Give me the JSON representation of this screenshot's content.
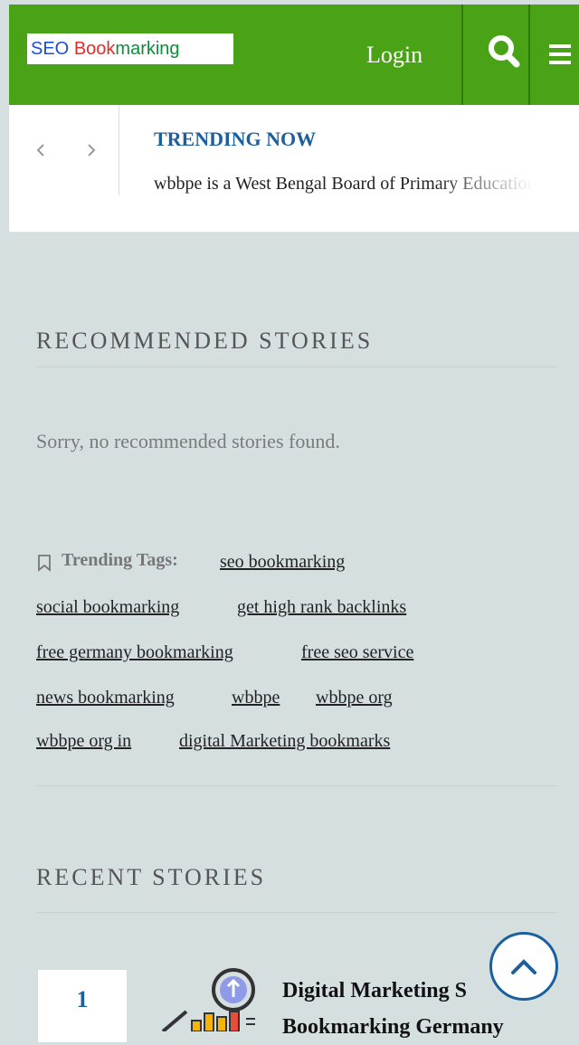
{
  "header": {
    "logo_text": "SEO Bookmarking",
    "login_label": "Login",
    "search_icon": "search-icon",
    "menu_icon": "hamburger-menu-icon",
    "bg_color": "#4aa316"
  },
  "trending": {
    "title": "TRENDING NOW",
    "text": "wbbpe is a West Bengal Board of Primary Education"
  },
  "recommended": {
    "title": "RECOMMENDED STORIES",
    "empty_message": "Sorry, no recommended stories found."
  },
  "tags": {
    "label": "Trending Tags:",
    "items": [
      "seo bookmarking",
      "social bookmarking",
      "get high rank backlinks",
      "free germany bookmarking",
      "free seo service",
      "news bookmarking",
      "wbbpe",
      "wbbpe org",
      "wbbpe org in",
      "digital Marketing bookmarks"
    ]
  },
  "recent": {
    "title": "RECENT STORIES",
    "stories": [
      {
        "rank": "1",
        "title_line1": "Digital Marketing S",
        "title_line2": "Bookmarking Germany"
      }
    ]
  },
  "colors": {
    "accent": "#1c5f9e",
    "background": "#d6dfdf"
  }
}
